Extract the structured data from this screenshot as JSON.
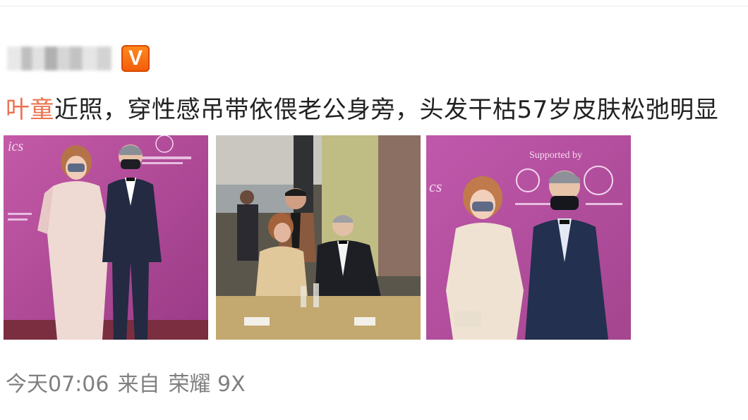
{
  "post": {
    "hashtag": "叶童",
    "text": "近照，穿性感吊带依偎老公身旁，头发干枯57岁皮肤松弛明显"
  },
  "photos": [
    {
      "name": "photo-couple-backdrop"
    },
    {
      "name": "photo-dinner-table"
    },
    {
      "name": "photo-couple-closeup"
    }
  ],
  "backdrop": {
    "supported_by": "Supported by"
  },
  "meta": {
    "time": "今天07:06",
    "from_label": "来自",
    "device": "荣耀 9X"
  },
  "colors": {
    "hashtag": "#eb7350",
    "vbadge": "#f25c0a",
    "backdrop": "#b04a9a"
  }
}
